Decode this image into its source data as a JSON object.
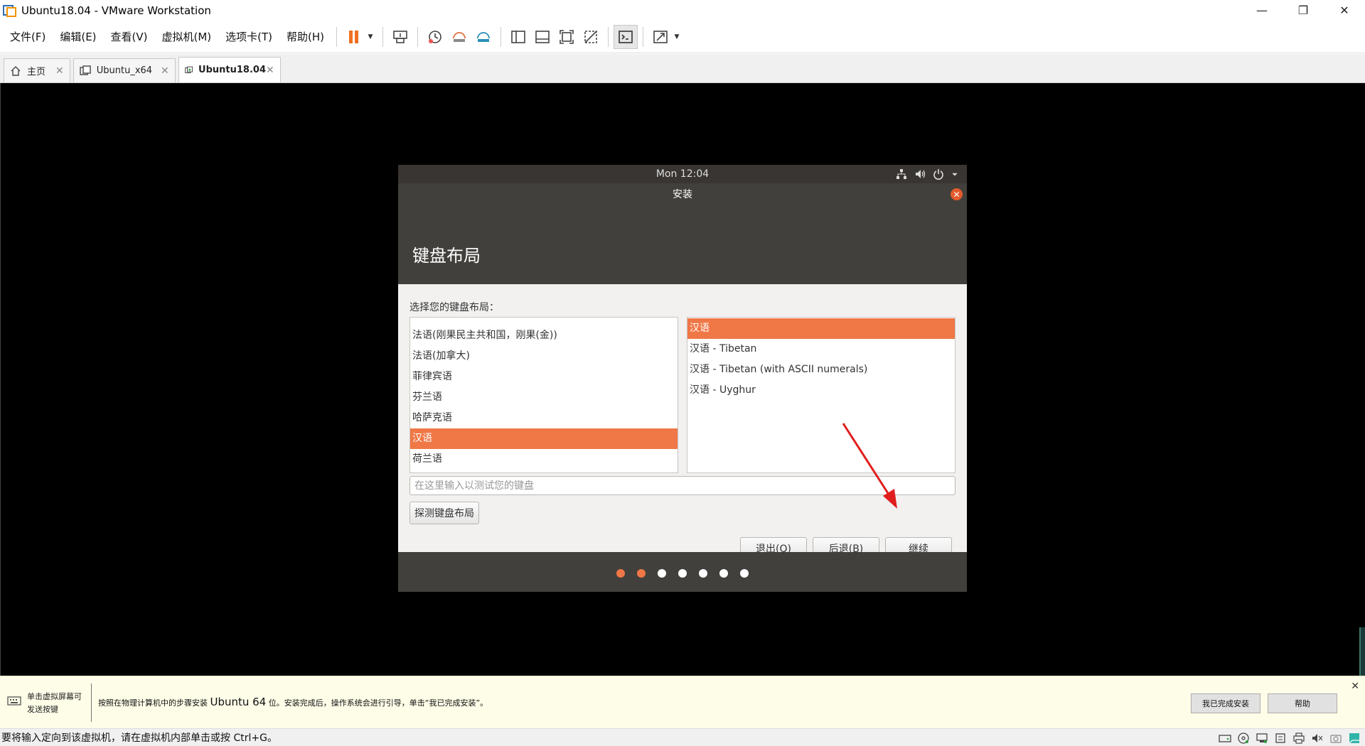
{
  "window": {
    "title": "Ubuntu18.04 - VMware Workstation",
    "controls": [
      "minimize",
      "restore",
      "close"
    ]
  },
  "menu": {
    "items": [
      {
        "label": "文件(F)"
      },
      {
        "label": "编辑(E)"
      },
      {
        "label": "查看(V)"
      },
      {
        "label": "虚拟机(M)"
      },
      {
        "label": "选项卡(T)"
      },
      {
        "label": "帮助(H)"
      }
    ]
  },
  "tabs": [
    {
      "label": "主页",
      "icon": "home-icon"
    },
    {
      "label": "Ubuntu_x64",
      "icon": "vm-icon"
    },
    {
      "label": "Ubuntu18.04",
      "icon": "vm-running-icon",
      "active": true
    }
  ],
  "ubuntu": {
    "topbar_clock": "Mon 12:04",
    "window_title": "安装",
    "page_title": "键盘布局",
    "prompt": "选择您的键盘布局：",
    "layouts": [
      {
        "label": "法语(刚果民主共和国，刚果(金))"
      },
      {
        "label": "法语(加拿大)"
      },
      {
        "label": "菲律宾语"
      },
      {
        "label": "芬兰语"
      },
      {
        "label": "哈萨克语"
      },
      {
        "label": "汉语",
        "selected": true
      },
      {
        "label": "荷兰语"
      }
    ],
    "variants": [
      {
        "label": "汉语",
        "selected": true
      },
      {
        "label": "汉语 - Tibetan"
      },
      {
        "label": "汉语 - Tibetan (with ASCII numerals)"
      },
      {
        "label": "汉语 - Uyghur"
      }
    ],
    "test_placeholder": "在这里输入以测试您的键盘",
    "detect_label": "探测键盘布局",
    "quit_label": "退出(Q)",
    "back_label": "后退(B)",
    "continue_label": "继续",
    "progress": {
      "total": 7,
      "completed": 2
    },
    "accent": "#f07746"
  },
  "hint": {
    "left_text": "单击虚拟屏幕可发送按键",
    "message_pre": "按照在物理计算机中的步骤安装 ",
    "message_os": "Ubuntu 64",
    "message_post": " 位。安装完成后，操作系统会进行引导，单击“我已完成安装”。",
    "done_label": "我已完成安装",
    "help_label": "帮助"
  },
  "status": {
    "text": "要将输入定向到该虚拟机，请在虚拟机内部单击或按 Ctrl+G。"
  }
}
